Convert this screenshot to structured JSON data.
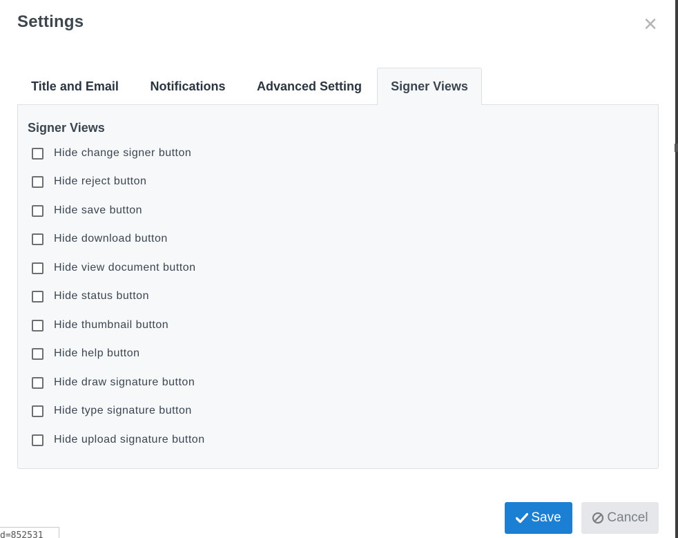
{
  "dialog": {
    "title": "Settings",
    "close_icon": "close-icon"
  },
  "tabs": [
    {
      "label": "Title and Email",
      "active": false
    },
    {
      "label": "Notifications",
      "active": false
    },
    {
      "label": "Advanced Setting",
      "active": false
    },
    {
      "label": "Signer Views",
      "active": true
    }
  ],
  "panel": {
    "heading": "Signer Views",
    "options": [
      {
        "label": "Hide change signer button",
        "checked": false
      },
      {
        "label": "Hide reject button",
        "checked": false
      },
      {
        "label": "Hide save button",
        "checked": false
      },
      {
        "label": "Hide download button",
        "checked": false
      },
      {
        "label": "Hide view document button",
        "checked": false
      },
      {
        "label": "Hide status button",
        "checked": false
      },
      {
        "label": "Hide thumbnail button",
        "checked": false
      },
      {
        "label": "Hide help button",
        "checked": false
      },
      {
        "label": "Hide draw signature button",
        "checked": false
      },
      {
        "label": "Hide type signature button",
        "checked": false
      },
      {
        "label": "Hide upload signature button",
        "checked": false
      }
    ]
  },
  "footer": {
    "save_label": "Save",
    "save_icon": "check-icon",
    "cancel_label": "Cancel",
    "cancel_icon": "ban-icon",
    "accent_color": "#1b7fd3",
    "id_fragment": "d=852531"
  }
}
